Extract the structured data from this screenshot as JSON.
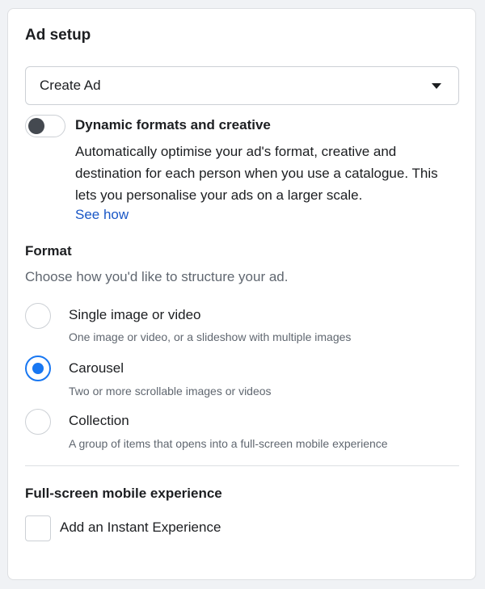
{
  "ad_setup": {
    "title": "Ad setup",
    "dropdown": {
      "selected": "Create Ad"
    },
    "dynamic": {
      "label": "Dynamic formats and creative",
      "enabled": false,
      "description": "Automatically optimise your ad's format, creative and destination for each person when you use a catalogue. This lets you personalise your ads on a larger scale.",
      "link": "See how"
    }
  },
  "format": {
    "title": "Format",
    "help": "Choose how you'd like to structure your ad.",
    "selected": "Carousel",
    "options": [
      {
        "label": "Single image or video",
        "description": "One image or video, or a slideshow with multiple images"
      },
      {
        "label": "Carousel",
        "description": "Two or more scrollable images or videos"
      },
      {
        "label": "Collection",
        "description": "A group of items that opens into a full-screen mobile experience"
      }
    ]
  },
  "fullscreen": {
    "title": "Full-screen mobile experience",
    "checkbox_label": "Add an Instant Experience",
    "checked": false
  },
  "colors": {
    "accent": "#1877f2",
    "link": "#1a57c6",
    "text": "#1c1e21",
    "muted": "#606770"
  }
}
